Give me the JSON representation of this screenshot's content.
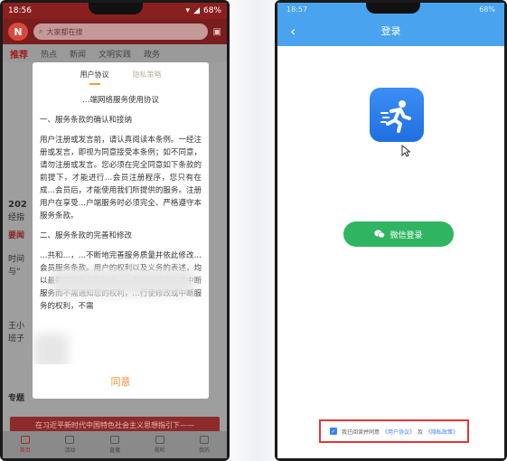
{
  "left_phone": {
    "status_time": "18:56",
    "battery": "68%",
    "search_placeholder": "大家都在搜",
    "tabs": [
      "推荐",
      "热点",
      "新闻",
      "文明实践",
      "政务"
    ],
    "bg_texts": {
      "line1": "202",
      "line2": "经指",
      "line3": "要闻",
      "line4": "时间",
      "line5": "与“",
      "line6": "王小",
      "line7": "班子",
      "line8": "专题"
    },
    "red_banner": "在习近平新时代中国特色社会主义思想指引下——",
    "bottom_nav": [
      "首页",
      "活动",
      "直播",
      "视听",
      "我的"
    ],
    "modal": {
      "tab_user": "用户协议",
      "tab_privacy": "隐私策略",
      "doc_title": "…端网络服务使用协议",
      "section1": "一、服务条款的确认和接纳",
      "para1": "用户注册或发言前，请认真阅读本条例。一经注册或发言，即视为同意接受本条例；如不同意，请勿注册或发言。您必须在完全同意如下条款的前提下，才能进行…会员注册程序，您只有在成…会员后，才能使用我们所提供的服务。注册用户在享受…户端服务时必须完全、严格遵守本服务条款。",
      "section2": "二、服务条款的完善和修改",
      "para2": "…共和…，…不断地完善服务质量并依此修改…会员服务条款。用户的权利以及义务的表述，均以最新的服务条款为准。…保留随时修改或中断服务而不需通知您的权利，…行使修改或中断服务的权利，不需",
      "agree_label": "同意"
    }
  },
  "right_phone": {
    "status_time": "18:57",
    "battery": "68%",
    "title": "登录",
    "wechat_login": "微信登录",
    "agreement_prefix": "我已阅读并同意",
    "user_agreement_link": "《用户协议》",
    "and_text": "及",
    "privacy_link": "《隐私政策》"
  },
  "colors": {
    "brand_red": "#8a1f1f",
    "agree_orange": "#e8913a",
    "login_blue": "#4aa3ef",
    "wechat_green": "#2fb561",
    "highlight_red": "#e0383a"
  }
}
